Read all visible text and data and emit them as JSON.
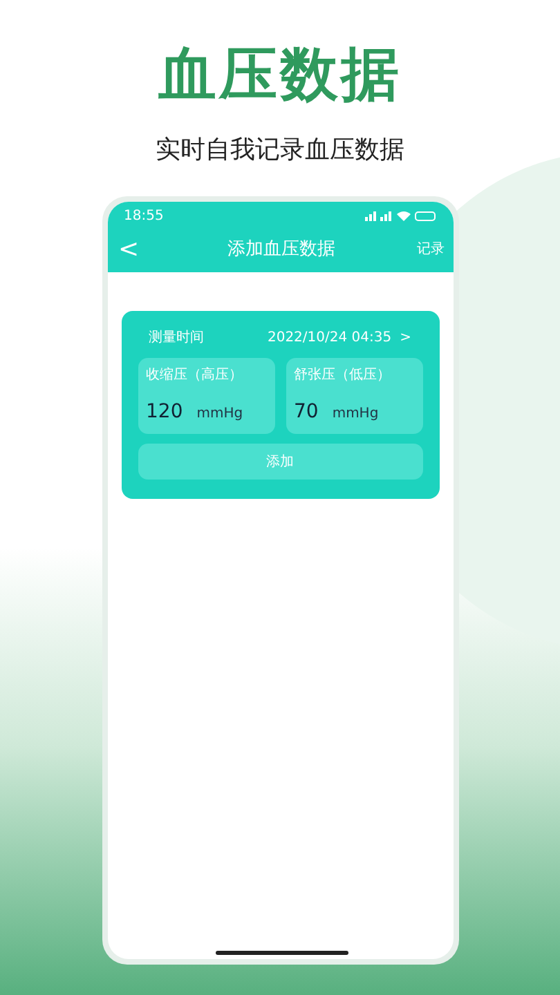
{
  "headline": "血压数据",
  "subtitle": "实时自我记录血压数据",
  "status_bar": {
    "time": "18:55"
  },
  "nav": {
    "back": "<",
    "title": "添加血压数据",
    "action": "记录"
  },
  "form": {
    "time_label": "测量时间",
    "time_value": "2022/10/24 04:35",
    "time_arrow": ">",
    "fields": [
      {
        "label": "收缩压（高压）",
        "value": "120",
        "unit": "mmHg"
      },
      {
        "label": "舒张压（低压）",
        "value": "70",
        "unit": "mmHg"
      }
    ],
    "button": "添加"
  }
}
